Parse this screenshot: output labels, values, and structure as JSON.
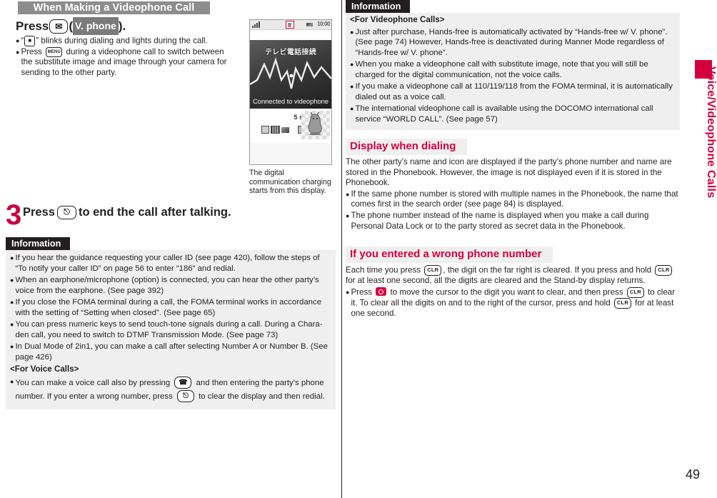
{
  "page": {
    "number": "49",
    "side_tab": "Voice/Videophone Calls",
    "accent_color": "#d3003f",
    "banner_gray": "#8d8d8d",
    "info_header_bg": "#231f20"
  },
  "left": {
    "banner": "When Making a Videophone Call",
    "step2": {
      "press_label": "Press",
      "key_mail_icon": "mail-key-icon",
      "open_paren": "(",
      "softkey_label": "V. phone",
      "close_paren": ").",
      "bullets": [
        {
          "pre": "“",
          "icon": "videophone-indicator-icon",
          "post": "” blinks during dialing and lights during the call."
        },
        {
          "pre": "Press ",
          "icon": "menu-key-icon",
          "post": " during a videophone call to switch between the substitute image and image through your camera for sending to the other party."
        }
      ]
    },
    "figure": {
      "status_time": "10:00",
      "video_title_jp": "テレビ電話接続",
      "video_caption": "Connected to videophone",
      "timer": "5 s",
      "caption": "The digital communication charging starts from this display."
    },
    "step3": {
      "number": "3",
      "pre": "Press",
      "key_icon": "end-call-key-icon",
      "post": "to end the call after talking."
    },
    "information": {
      "header": "Information",
      "bullets": [
        "If you hear the guidance requesting your caller ID (see page 420), follow the steps of “To notify your caller ID” on page 56 to enter “186” and redial.",
        "When an earphone/microphone (option) is connected, you can hear the other party’s voice from the earphone. (See page 392)",
        "If you close the FOMA terminal during a call, the FOMA terminal works in accordance with the setting of “Setting when closed”. (See page 65)",
        "You can press numeric keys to send touch-tone signals during a call. During a Chara-den call, you need to switch to DTMF Transmission Mode. (See page 73)",
        "In Dual Mode of 2in1, you can make a call after selecting Number A or Number B. (See page 426)"
      ],
      "sub_head": "<For Voice Calls>",
      "voice_bullet": {
        "pre": "You can make a voice call also by pressing ",
        "icon1": "call-key-icon",
        "mid": " and then entering the party’s phone number. If you enter a wrong number, press ",
        "icon2": "end-call-key-icon",
        "post": " to clear the display and then redial."
      }
    }
  },
  "right": {
    "information": {
      "header": "Information",
      "sub_head": "<For Videophone Calls>",
      "bullets": [
        "Just after purchase, Hands-free is automatically activated by “Hands-free w/ V. phone”. (See page 74) However, Hands-free is deactivated during Manner Mode regardless of “Hands-free w/ V. phone”.",
        "When you make a videophone call with substitute image, note that you will still be charged for the digital communication, not the voice calls.",
        "If you make a videophone call at 110/119/118 from the FOMA terminal, it is automatically dialed out as a voice call.",
        "The international videophone call is available using the DOCOMO international call service “WORLD CALL”. (See page 57)"
      ]
    },
    "display_when_dialing": {
      "heading": "Display when dialing",
      "paragraph": "The other party’s name and icon are displayed if the party’s phone number and name are stored in the Phonebook. However, the image is not displayed even if it is stored in the Phonebook.",
      "bullets": [
        "If the same phone number is stored with multiple names in the Phonebook, the name that comes first in the search order (see page 84) is displayed.",
        "The phone number instead of the name is displayed when you make a call during Personal Data Lock or to the party stored as secret data in the Phonebook."
      ]
    },
    "wrong_number": {
      "heading": "If you entered a wrong phone number",
      "para": {
        "p1": "Each time you press ",
        "key1": "CLR",
        "p2": ", the digit on the far right is cleared. If you press and hold ",
        "key2": "CLR",
        "p3": " for at least one second, all the digits are cleared and the Stand-by display returns."
      },
      "bullet": {
        "b1": "Press ",
        "navkey": "navigation-key-icon",
        "b2": " to move the cursor to the digit you want to clear, and then press ",
        "key3": "CLR",
        "b3": " to clear it. To clear all the digits on and to the right of the cursor, press and hold ",
        "key4": "CLR",
        "b4": " for at least one second."
      }
    }
  }
}
